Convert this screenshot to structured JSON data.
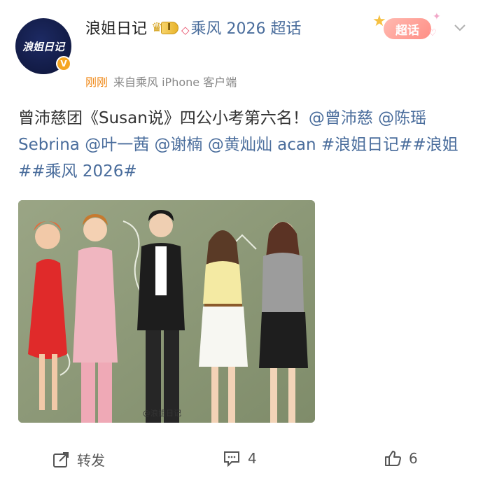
{
  "author": {
    "name": "浪姐日记",
    "avatar_text": "浪姐日记",
    "verified_badge": "V",
    "level_label": "I",
    "topic": "乘风 2026 超话",
    "time": "刚刚",
    "source": "来自乘风 iPhone 客户端"
  },
  "chaohua": {
    "label": "超话"
  },
  "post": {
    "segments": [
      {
        "text": "曾沛慈团《Susan说》四公小考第六名！",
        "type": "text"
      },
      {
        "text": "@曾沛慈",
        "type": "link"
      },
      {
        "text": " ",
        "type": "text"
      },
      {
        "text": "@陈瑶 Sebrina",
        "type": "link"
      },
      {
        "text": " ",
        "type": "text"
      },
      {
        "text": "@叶一茜",
        "type": "link"
      },
      {
        "text": " ",
        "type": "text"
      },
      {
        "text": "@谢楠",
        "type": "link"
      },
      {
        "text": " ",
        "type": "text"
      },
      {
        "text": "@黄灿灿 acan",
        "type": "link"
      },
      {
        "text": " ",
        "type": "text"
      },
      {
        "text": "#浪姐日记#",
        "type": "link"
      },
      {
        "text": "#浪姐#",
        "type": "link"
      },
      {
        "text": "#乘风 2026#",
        "type": "link"
      }
    ]
  },
  "image": {
    "watermark": "@浪姐日记"
  },
  "actions": {
    "repost_label": "转发",
    "comment_count": "4",
    "like_count": "6"
  },
  "colors": {
    "link": "#4a6d9c",
    "time": "#f08a1a",
    "photo_bg": "#8e9a78"
  }
}
